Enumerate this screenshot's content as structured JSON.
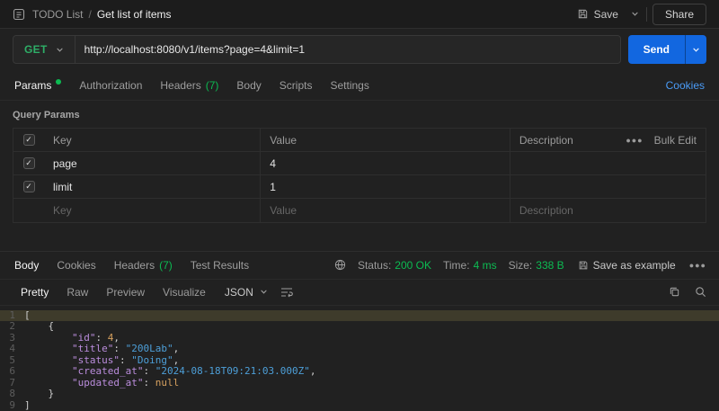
{
  "icons": {
    "check": "✓",
    "more": "●●●"
  },
  "colors": {
    "send_button": "#1267e0",
    "success_green": "#0cbb52",
    "link_blue": "#4a9cf8",
    "method_get_green": "#2eae67",
    "json_key": "#bb8ddd",
    "json_string": "#4d9fd8",
    "json_number": "#d7a15f",
    "highlight_line": "rgba(216,197,100,.16)"
  },
  "topbar": {
    "collection": "TODO List",
    "separator": "/",
    "request_name": "Get list of items",
    "save_label": "Save",
    "share_label": "Share"
  },
  "request": {
    "method": "GET",
    "url": "http://localhost:8080/v1/items?page=4&limit=1",
    "send_label": "Send"
  },
  "tabs": {
    "params": "Params",
    "authorization": "Authorization",
    "headers": "Headers",
    "headers_count": "(7)",
    "body": "Body",
    "scripts": "Scripts",
    "settings": "Settings",
    "cookies": "Cookies"
  },
  "params": {
    "title": "Query Params",
    "col_key": "Key",
    "col_value": "Value",
    "col_description": "Description",
    "bulk_edit": "Bulk Edit",
    "rows": [
      {
        "key": "page",
        "value": "4",
        "description": ""
      },
      {
        "key": "limit",
        "value": "1",
        "description": ""
      }
    ],
    "placeholder": {
      "key": "Key",
      "value": "Value",
      "description": "Description"
    }
  },
  "response": {
    "tab_body": "Body",
    "tab_cookies": "Cookies",
    "tab_headers": "Headers",
    "tab_headers_count": "(7)",
    "tab_test_results": "Test Results",
    "status_label": "Status:",
    "status_value": "200 OK",
    "time_label": "Time:",
    "time_value": "4 ms",
    "size_label": "Size:",
    "size_value": "338 B",
    "save_as_example": "Save as example",
    "view_pretty": "Pretty",
    "view_raw": "Raw",
    "view_preview": "Preview",
    "view_visualize": "Visualize",
    "format": "JSON"
  },
  "code": {
    "l1": {
      "n": "1",
      "a": "["
    },
    "l2": {
      "n": "2",
      "a": "    {"
    },
    "l3": {
      "n": "3",
      "a": "        ",
      "k": "\"id\"",
      "c": ": ",
      "v": "4",
      "z": ","
    },
    "l4": {
      "n": "4",
      "a": "        ",
      "k": "\"title\"",
      "c": ": ",
      "v": "\"200Lab\"",
      "z": ","
    },
    "l5": {
      "n": "5",
      "a": "        ",
      "k": "\"status\"",
      "c": ": ",
      "v": "\"Doing\"",
      "z": ","
    },
    "l6": {
      "n": "6",
      "a": "        ",
      "k": "\"created_at\"",
      "c": ": ",
      "v": "\"2024-08-18T09:21:03.000Z\"",
      "z": ","
    },
    "l7": {
      "n": "7",
      "a": "        ",
      "k": "\"updated_at\"",
      "c": ": ",
      "v": "null"
    },
    "l8": {
      "n": "8",
      "a": "    }"
    },
    "l9": {
      "n": "9",
      "a": "]"
    }
  }
}
